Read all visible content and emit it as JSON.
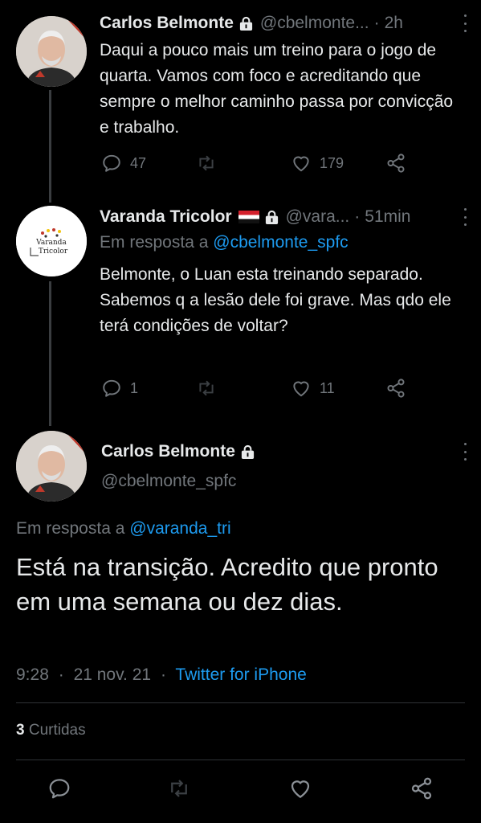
{
  "tweets": [
    {
      "name": "Carlos Belmonte",
      "handle": "@cbelmonte...",
      "time": "2h",
      "text": "Daqui a pouco mais um treino para o jogo de quarta. Vamos com foco e acreditando que sempre o melhor caminho passa por convicção e trabalho.",
      "replies": "47",
      "retweets": "",
      "likes": "179"
    },
    {
      "name": "Varanda Tricolor",
      "handle": "@vara...",
      "time": "51min",
      "reply_prefix": "Em resposta a",
      "reply_mention": "@cbelmonte_spfc",
      "text": "Belmonte, o Luan esta treinando separado. Sabemos q a lesão dele foi grave. Mas qdo ele terá condições de voltar?",
      "replies": "1",
      "retweets": "",
      "likes": "11",
      "avatar_text_1": "Varanda",
      "avatar_text_2": "Tricolor"
    }
  ],
  "main_tweet": {
    "name": "Carlos Belmonte",
    "handle": "@cbelmonte_spfc",
    "reply_prefix": "Em resposta a",
    "reply_mention": "@varanda_tri",
    "text": "Está na transição. Acredito que pronto em uma semana ou dez dias.",
    "time": "9:28",
    "date": "21 nov. 21",
    "source": "Twitter for iPhone",
    "likes_count": "3",
    "likes_label": "Curtidas"
  },
  "colors": {
    "background": "#000000",
    "text": "#e7e9ea",
    "muted": "#71767b",
    "link": "#1d9bf0",
    "divider": "#2f3336"
  },
  "icons": [
    "lock-icon",
    "reply-icon",
    "retweet-icon",
    "like-icon",
    "share-icon",
    "more-icon",
    "flag-icon"
  ]
}
